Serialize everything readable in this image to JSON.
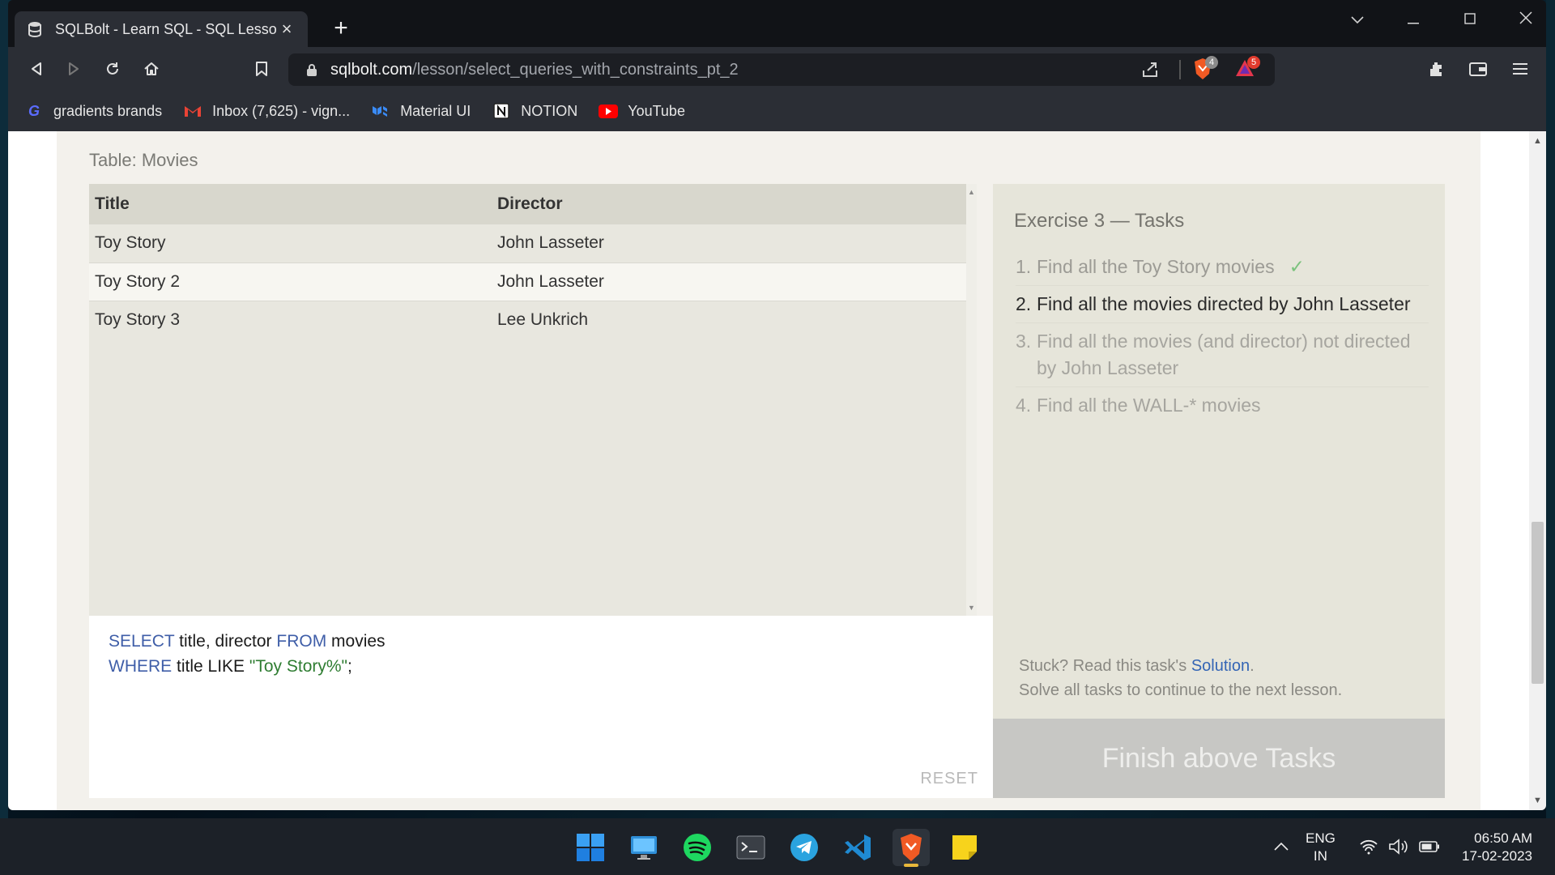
{
  "browser": {
    "tab_title": "SQLBolt - Learn SQL - SQL Lesson",
    "url_host": "sqlbolt.com",
    "url_path": "/lesson/select_queries_with_constraints_pt_2",
    "shields_count": "4",
    "rewards_count": "5",
    "bookmarks": [
      {
        "label": "gradients brands"
      },
      {
        "label": "Inbox (7,625) - vign..."
      },
      {
        "label": "Material UI"
      },
      {
        "label": "NOTION"
      },
      {
        "label": "YouTube"
      }
    ]
  },
  "lesson": {
    "table_label": "Table: Movies",
    "columns": [
      "Title",
      "Director"
    ],
    "rows": [
      {
        "title": "Toy Story",
        "director": "John Lasseter"
      },
      {
        "title": "Toy Story 2",
        "director": "John Lasseter"
      },
      {
        "title": "Toy Story 3",
        "director": "Lee Unkrich"
      }
    ],
    "query": {
      "line1": {
        "kw1": "SELECT",
        "t1": " title, director ",
        "kw2": "FROM",
        "t2": " movies"
      },
      "line2": {
        "kw1": "WHERE",
        "t1": " title LIKE ",
        "str": "\"Toy Story%\"",
        "t2": ";"
      }
    },
    "reset_label": "RESET",
    "tasks_title": "Exercise 3 — Tasks",
    "tasks": [
      {
        "num": "1.",
        "text": "Find all the Toy Story movies",
        "check": "✓"
      },
      {
        "num": "2.",
        "text": "Find all the movies directed by John Lasseter"
      },
      {
        "num": "3.",
        "text": "Find all the movies (and director) not directed by John Lasseter"
      },
      {
        "num": "4.",
        "text": "Find all the WALL-* movies"
      }
    ],
    "hint_prefix": "Stuck? Read this task's ",
    "hint_link": "Solution",
    "hint_suffix": ".",
    "hint_line2": "Solve all tasks to continue to the next lesson.",
    "finish_label": "Finish above Tasks"
  },
  "taskbar": {
    "lang_top": "ENG",
    "lang_bottom": "IN",
    "time": "06:50 AM",
    "date": "17-02-2023"
  }
}
